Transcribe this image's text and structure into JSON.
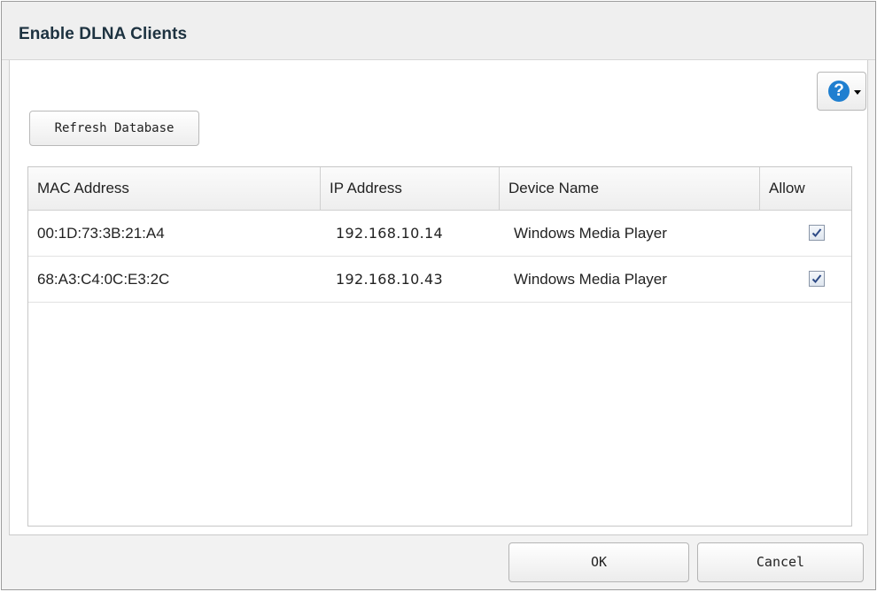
{
  "dialog": {
    "title": "Enable DLNA Clients",
    "help_glyph": "?",
    "help_icon": "help-question-icon",
    "dropdown_icon": "caret-down-icon"
  },
  "toolbar": {
    "refresh_label": "Refresh Database"
  },
  "table": {
    "columns": [
      "MAC Address",
      "IP Address",
      "Device Name",
      "Allow"
    ],
    "rows": [
      {
        "mac": "00:1D:73:3B:21:A4",
        "ip": "192.168.10.14",
        "device": "Windows Media Player",
        "allow": true
      },
      {
        "mac": "68:A3:C4:0C:E3:2C",
        "ip": "192.168.10.43",
        "device": "Windows Media Player",
        "allow": true
      }
    ]
  },
  "footer": {
    "ok_label": "OK",
    "cancel_label": "Cancel"
  },
  "colors": {
    "title": "#1d3240",
    "help_accent": "#1f7fd0",
    "checkmark": "#2d4a86"
  }
}
